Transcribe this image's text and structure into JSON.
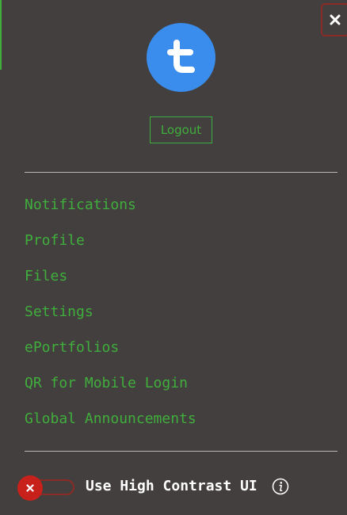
{
  "panel": {
    "close_icon": "close-icon",
    "avatar_letter": "t",
    "avatar_color": "#3b8ded",
    "logout_label": "Logout"
  },
  "menu": {
    "items": [
      {
        "label": "Notifications"
      },
      {
        "label": "Profile"
      },
      {
        "label": "Files"
      },
      {
        "label": "Settings"
      },
      {
        "label": "ePortfolios"
      },
      {
        "label": "QR for Mobile Login"
      },
      {
        "label": "Global Announcements"
      }
    ]
  },
  "settings": {
    "high_contrast_label": "Use High Contrast UI",
    "high_contrast_enabled": false,
    "info_icon": "info-icon"
  },
  "colors": {
    "background": "#433f3e",
    "accent_green": "#3fae3c",
    "toggle_red": "#c8211b",
    "border_red": "#8a2b26"
  }
}
